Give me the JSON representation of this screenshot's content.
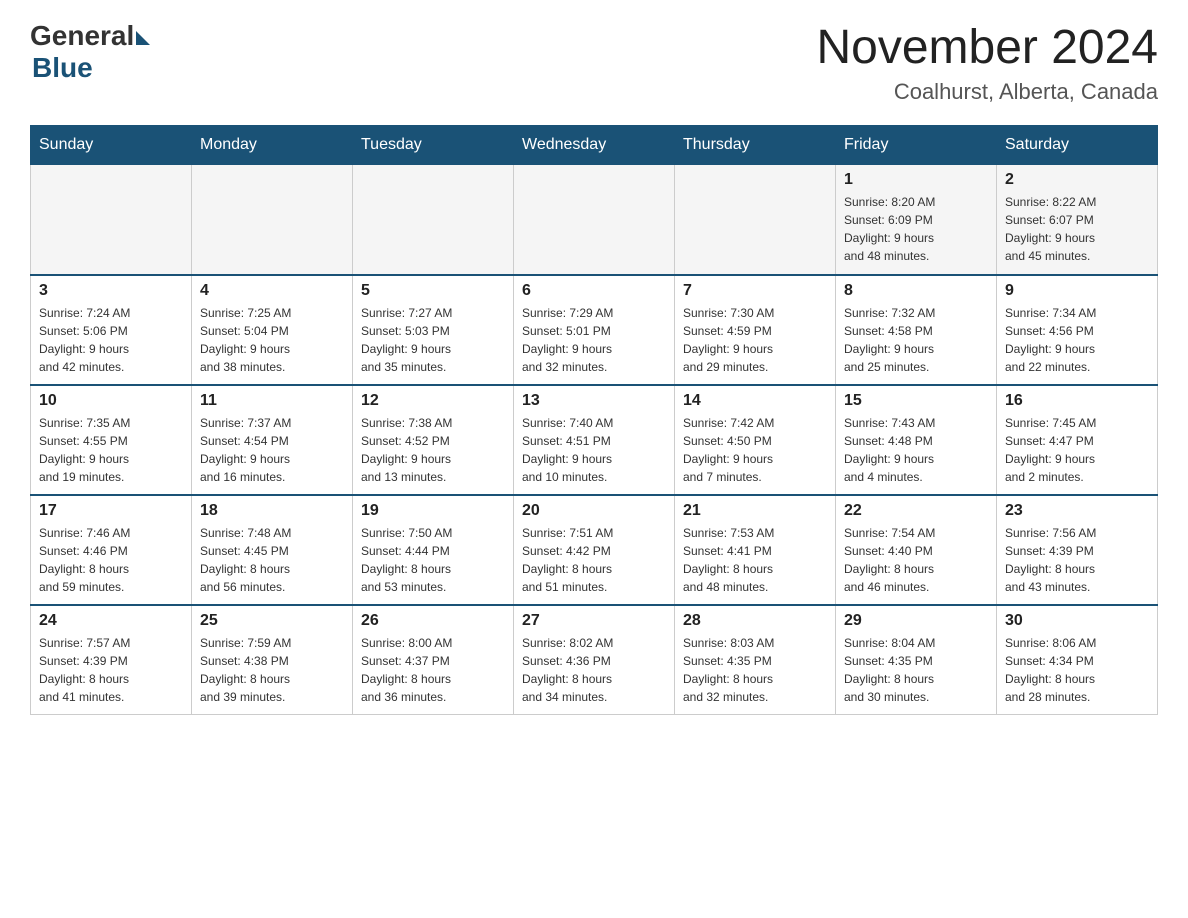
{
  "header": {
    "logo_general": "General",
    "logo_blue": "Blue",
    "month_year": "November 2024",
    "location": "Coalhurst, Alberta, Canada"
  },
  "days_of_week": [
    "Sunday",
    "Monday",
    "Tuesday",
    "Wednesday",
    "Thursday",
    "Friday",
    "Saturday"
  ],
  "weeks": [
    [
      {
        "day": "",
        "info": ""
      },
      {
        "day": "",
        "info": ""
      },
      {
        "day": "",
        "info": ""
      },
      {
        "day": "",
        "info": ""
      },
      {
        "day": "",
        "info": ""
      },
      {
        "day": "1",
        "info": "Sunrise: 8:20 AM\nSunset: 6:09 PM\nDaylight: 9 hours\nand 48 minutes."
      },
      {
        "day": "2",
        "info": "Sunrise: 8:22 AM\nSunset: 6:07 PM\nDaylight: 9 hours\nand 45 minutes."
      }
    ],
    [
      {
        "day": "3",
        "info": "Sunrise: 7:24 AM\nSunset: 5:06 PM\nDaylight: 9 hours\nand 42 minutes."
      },
      {
        "day": "4",
        "info": "Sunrise: 7:25 AM\nSunset: 5:04 PM\nDaylight: 9 hours\nand 38 minutes."
      },
      {
        "day": "5",
        "info": "Sunrise: 7:27 AM\nSunset: 5:03 PM\nDaylight: 9 hours\nand 35 minutes."
      },
      {
        "day": "6",
        "info": "Sunrise: 7:29 AM\nSunset: 5:01 PM\nDaylight: 9 hours\nand 32 minutes."
      },
      {
        "day": "7",
        "info": "Sunrise: 7:30 AM\nSunset: 4:59 PM\nDaylight: 9 hours\nand 29 minutes."
      },
      {
        "day": "8",
        "info": "Sunrise: 7:32 AM\nSunset: 4:58 PM\nDaylight: 9 hours\nand 25 minutes."
      },
      {
        "day": "9",
        "info": "Sunrise: 7:34 AM\nSunset: 4:56 PM\nDaylight: 9 hours\nand 22 minutes."
      }
    ],
    [
      {
        "day": "10",
        "info": "Sunrise: 7:35 AM\nSunset: 4:55 PM\nDaylight: 9 hours\nand 19 minutes."
      },
      {
        "day": "11",
        "info": "Sunrise: 7:37 AM\nSunset: 4:54 PM\nDaylight: 9 hours\nand 16 minutes."
      },
      {
        "day": "12",
        "info": "Sunrise: 7:38 AM\nSunset: 4:52 PM\nDaylight: 9 hours\nand 13 minutes."
      },
      {
        "day": "13",
        "info": "Sunrise: 7:40 AM\nSunset: 4:51 PM\nDaylight: 9 hours\nand 10 minutes."
      },
      {
        "day": "14",
        "info": "Sunrise: 7:42 AM\nSunset: 4:50 PM\nDaylight: 9 hours\nand 7 minutes."
      },
      {
        "day": "15",
        "info": "Sunrise: 7:43 AM\nSunset: 4:48 PM\nDaylight: 9 hours\nand 4 minutes."
      },
      {
        "day": "16",
        "info": "Sunrise: 7:45 AM\nSunset: 4:47 PM\nDaylight: 9 hours\nand 2 minutes."
      }
    ],
    [
      {
        "day": "17",
        "info": "Sunrise: 7:46 AM\nSunset: 4:46 PM\nDaylight: 8 hours\nand 59 minutes."
      },
      {
        "day": "18",
        "info": "Sunrise: 7:48 AM\nSunset: 4:45 PM\nDaylight: 8 hours\nand 56 minutes."
      },
      {
        "day": "19",
        "info": "Sunrise: 7:50 AM\nSunset: 4:44 PM\nDaylight: 8 hours\nand 53 minutes."
      },
      {
        "day": "20",
        "info": "Sunrise: 7:51 AM\nSunset: 4:42 PM\nDaylight: 8 hours\nand 51 minutes."
      },
      {
        "day": "21",
        "info": "Sunrise: 7:53 AM\nSunset: 4:41 PM\nDaylight: 8 hours\nand 48 minutes."
      },
      {
        "day": "22",
        "info": "Sunrise: 7:54 AM\nSunset: 4:40 PM\nDaylight: 8 hours\nand 46 minutes."
      },
      {
        "day": "23",
        "info": "Sunrise: 7:56 AM\nSunset: 4:39 PM\nDaylight: 8 hours\nand 43 minutes."
      }
    ],
    [
      {
        "day": "24",
        "info": "Sunrise: 7:57 AM\nSunset: 4:39 PM\nDaylight: 8 hours\nand 41 minutes."
      },
      {
        "day": "25",
        "info": "Sunrise: 7:59 AM\nSunset: 4:38 PM\nDaylight: 8 hours\nand 39 minutes."
      },
      {
        "day": "26",
        "info": "Sunrise: 8:00 AM\nSunset: 4:37 PM\nDaylight: 8 hours\nand 36 minutes."
      },
      {
        "day": "27",
        "info": "Sunrise: 8:02 AM\nSunset: 4:36 PM\nDaylight: 8 hours\nand 34 minutes."
      },
      {
        "day": "28",
        "info": "Sunrise: 8:03 AM\nSunset: 4:35 PM\nDaylight: 8 hours\nand 32 minutes."
      },
      {
        "day": "29",
        "info": "Sunrise: 8:04 AM\nSunset: 4:35 PM\nDaylight: 8 hours\nand 30 minutes."
      },
      {
        "day": "30",
        "info": "Sunrise: 8:06 AM\nSunset: 4:34 PM\nDaylight: 8 hours\nand 28 minutes."
      }
    ]
  ]
}
